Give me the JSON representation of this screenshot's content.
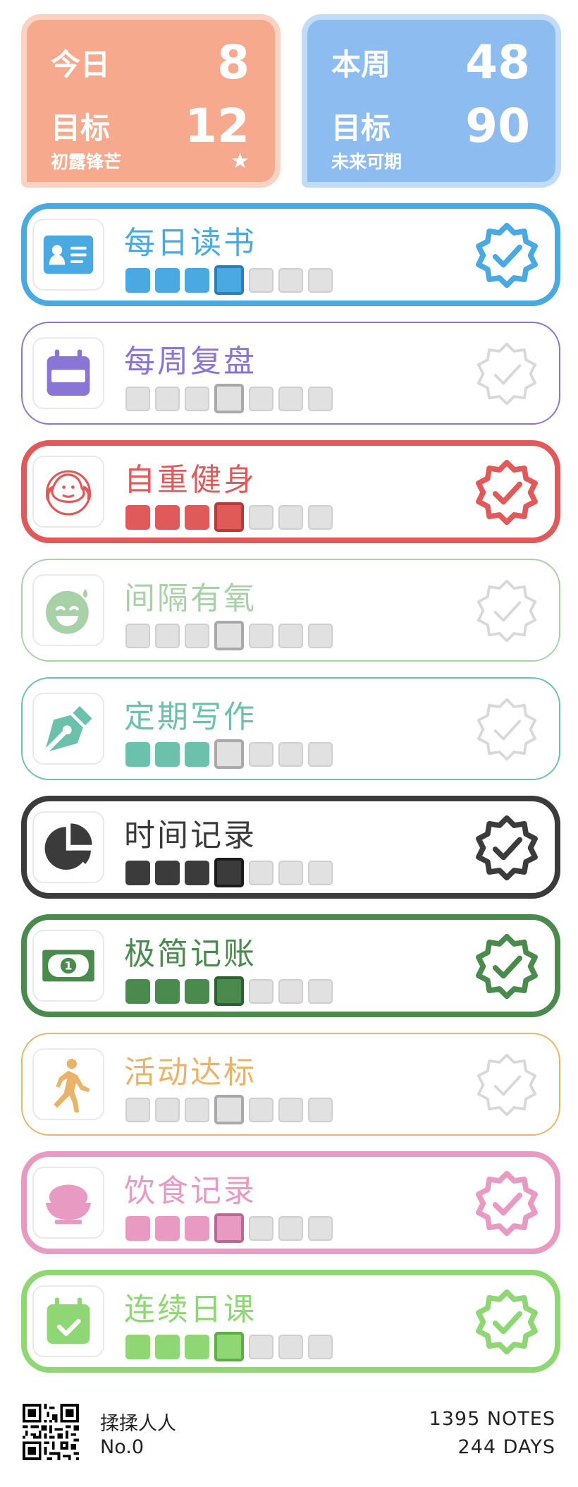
{
  "stats": {
    "today": {
      "label": "今日",
      "value": "8",
      "goal_label": "目标",
      "goal_value": "12",
      "motto": "初露锋芒"
    },
    "week": {
      "label": "本周",
      "value": "48",
      "goal_label": "目标",
      "goal_value": "90",
      "motto": "未来可期"
    }
  },
  "habits": [
    {
      "title": "每日读书",
      "color": "#4aa9e0",
      "dark": "#2b7fb3",
      "done": true,
      "filled": 4,
      "icon": "contact-card-icon"
    },
    {
      "title": "每周复盘",
      "color": "#8a74d6",
      "dark": "#6a55b6",
      "done": false,
      "filled": 0,
      "icon": "calendar-icon"
    },
    {
      "title": "自重健身",
      "color": "#e05a5a",
      "dark": "#b53b3b",
      "done": true,
      "filled": 4,
      "icon": "muscle-mascot-icon"
    },
    {
      "title": "间隔有氧",
      "color": "#a9d1a7",
      "dark": "#7fae7d",
      "done": false,
      "filled": 0,
      "icon": "sweat-smile-icon"
    },
    {
      "title": "定期写作",
      "color": "#6cc1ad",
      "dark": "#469a86",
      "done": false,
      "filled": 3,
      "icon": "pen-nib-icon"
    },
    {
      "title": "时间记录",
      "color": "#3b3b3b",
      "dark": "#1b1b1b",
      "done": true,
      "filled": 4,
      "icon": "pie-chart-icon"
    },
    {
      "title": "极简记账",
      "color": "#4a8a4d",
      "dark": "#2e6131",
      "done": true,
      "filled": 4,
      "icon": "money-bill-icon"
    },
    {
      "title": "活动达标",
      "color": "#eab36a",
      "dark": "#c28b42",
      "done": false,
      "filled": 0,
      "icon": "walking-person-icon"
    },
    {
      "title": "饮食记录",
      "color": "#e99ac2",
      "dark": "#b86b92",
      "done": true,
      "filled": 4,
      "icon": "rice-bowl-icon"
    },
    {
      "title": "连续日课",
      "color": "#8fd774",
      "dark": "#5fae45",
      "done": true,
      "filled": 4,
      "icon": "calendar-check-icon"
    }
  ],
  "footer": {
    "author": "揉揉人人",
    "author_no": "No.0",
    "notes": "1395 NOTES",
    "days": "244 DAYS"
  }
}
